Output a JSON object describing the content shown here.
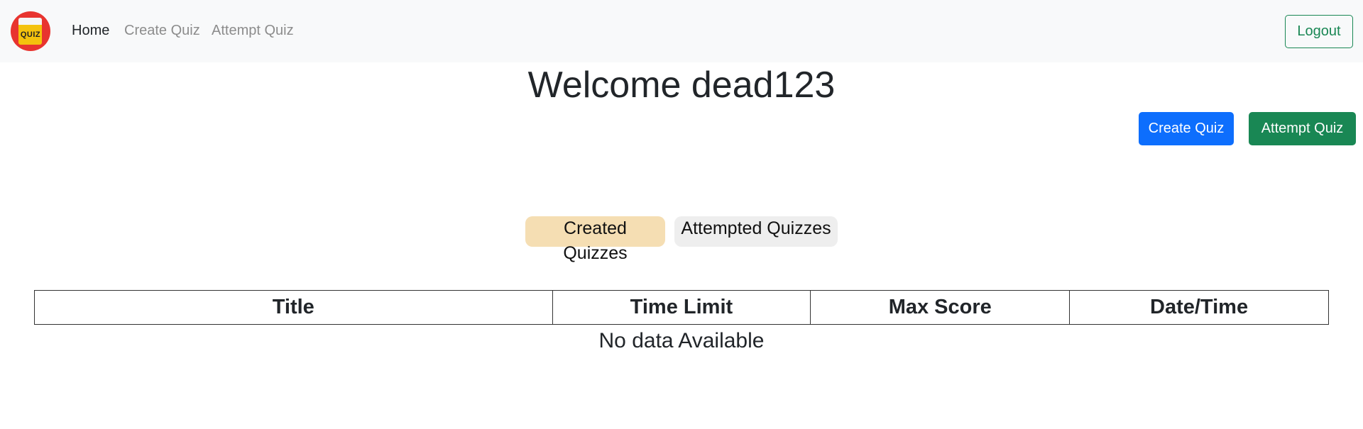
{
  "navbar": {
    "logo_text": "QUIZ",
    "links": [
      {
        "label": "Home",
        "active": true
      },
      {
        "label": "Create Quiz",
        "active": false
      },
      {
        "label": "Attempt Quiz",
        "active": false
      }
    ],
    "logout_label": "Logout"
  },
  "welcome": {
    "title": "Welcome dead123"
  },
  "actions": {
    "create_label": "Create Quiz",
    "attempt_label": "Attempt Quiz"
  },
  "tabs": [
    {
      "label": "Created Quizzes",
      "selected": true
    },
    {
      "label": "Attempted Quizzes",
      "selected": false
    }
  ],
  "table": {
    "columns": [
      "Title",
      "Time Limit",
      "Max Score",
      "Date/Time"
    ],
    "rows": [],
    "empty_message": "No data Available"
  },
  "colors": {
    "navbar_bg": "#f8f9fa",
    "primary": "#0d6efd",
    "success": "#198754",
    "tab_selected": "#f5deb3",
    "tab_unselected": "#eeeeee",
    "logo_red": "#e8342f",
    "logo_yellow": "#f4c20d"
  }
}
